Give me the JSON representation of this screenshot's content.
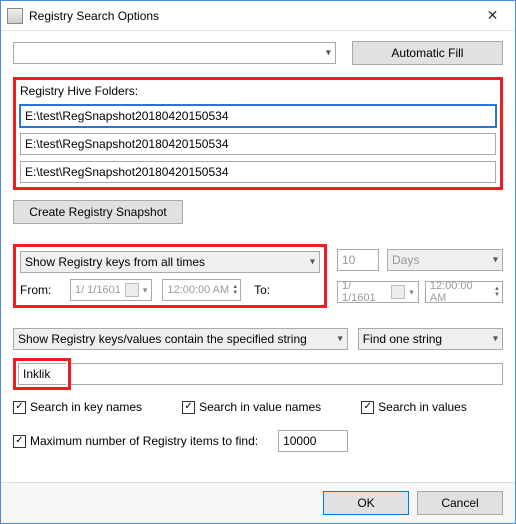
{
  "window": {
    "title": "Registry Search Options"
  },
  "top": {
    "automatic_fill": "Automatic Fill"
  },
  "hive": {
    "label": "Registry Hive Folders:",
    "path1": "E:\\test\\RegSnapshot20180420150534",
    "path2": "E:\\test\\RegSnapshot20180420150534",
    "path3": "E:\\test\\RegSnapshot20180420150534",
    "snapshot_btn": "Create Registry Snapshot"
  },
  "time": {
    "mode_label": "Show Registry keys from all times",
    "days_value": "10",
    "days_unit": "Days",
    "from_label": "From:",
    "to_label": "To:",
    "date1": "1/  1/1601",
    "time1": "12:00:00 AM",
    "date2": "1/  1/1601",
    "time2": "12:00:00 AM"
  },
  "search": {
    "contain_label": "Show Registry keys/values contain the specified string",
    "find_mode": "Find one string",
    "query": "Inklik",
    "key_names": "Search in key names",
    "value_names": "Search in value names",
    "values": "Search in values"
  },
  "limit": {
    "label": "Maximum number of Registry items to find:",
    "value": "10000"
  },
  "buttons": {
    "ok": "OK",
    "cancel": "Cancel"
  },
  "check_glyph": "✓"
}
